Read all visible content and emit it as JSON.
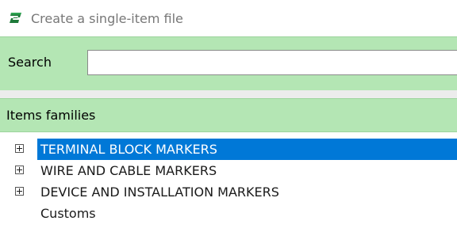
{
  "window": {
    "title": "Create a single-item file",
    "app_icon": "app-logo-icon"
  },
  "search": {
    "label": "Search",
    "value": "",
    "placeholder": ""
  },
  "families": {
    "header": "Items families",
    "items": [
      {
        "label": "TERMINAL BLOCK MARKERS",
        "expandable": true,
        "selected": true
      },
      {
        "label": "WIRE AND CABLE MARKERS",
        "expandable": true,
        "selected": false
      },
      {
        "label": "DEVICE AND INSTALLATION MARKERS",
        "expandable": true,
        "selected": false
      },
      {
        "label": "Customs",
        "expandable": false,
        "selected": false
      }
    ]
  },
  "colors": {
    "panel_green": "#b4e6b4",
    "selection_blue": "#0078d7",
    "logo_green": "#1f7a3a"
  }
}
